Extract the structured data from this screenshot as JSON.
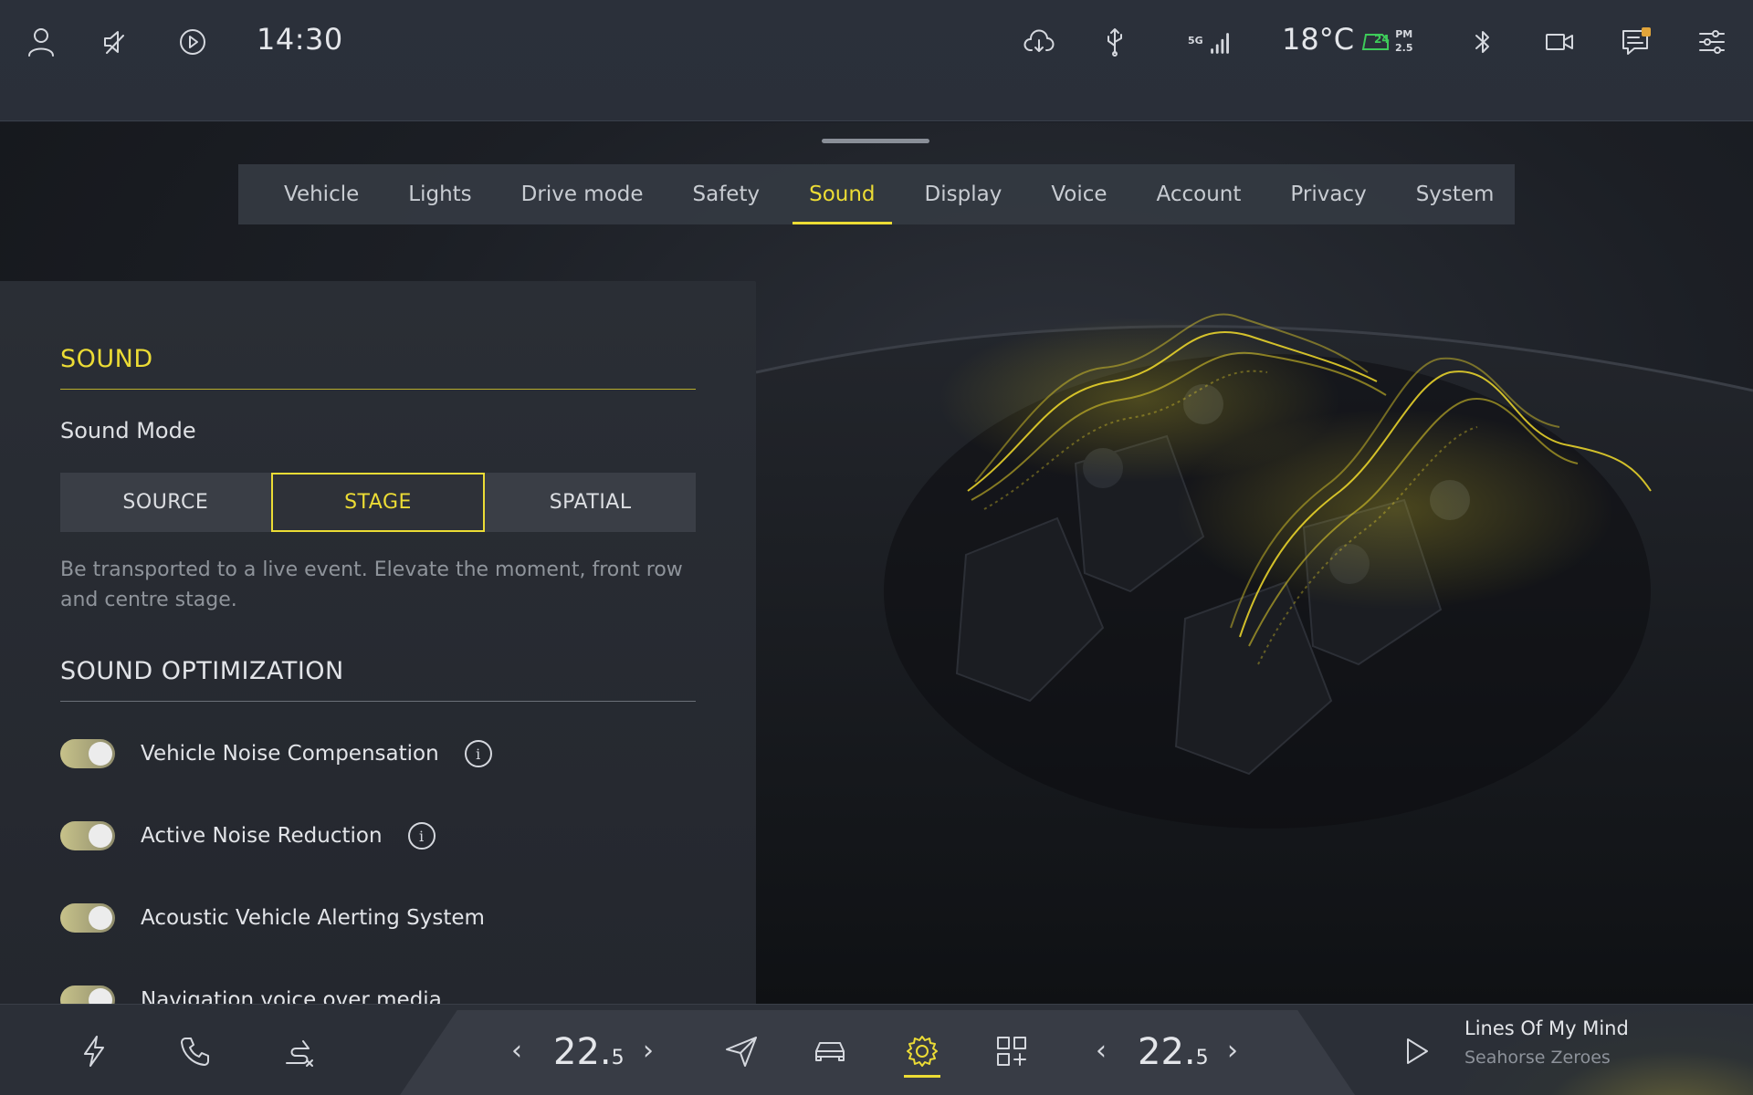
{
  "status_bar": {
    "time": "14:30",
    "signal_label": "5G",
    "temperature": "18°C",
    "aqi_value": "24",
    "pm_label": "PM",
    "pm_value": "2.5",
    "icons": [
      "profile-icon",
      "mute-icon",
      "play-circle-icon",
      "cloud-download-icon",
      "usb-icon",
      "signal-icon",
      "aqi-icon",
      "bluetooth-icon",
      "camera-icon",
      "messages-icon",
      "settings-sliders-icon"
    ]
  },
  "tabs": [
    {
      "label": "Vehicle"
    },
    {
      "label": "Lights"
    },
    {
      "label": "Drive mode"
    },
    {
      "label": "Safety"
    },
    {
      "label": "Sound",
      "active": true
    },
    {
      "label": "Display"
    },
    {
      "label": "Voice"
    },
    {
      "label": "Account"
    },
    {
      "label": "Privacy"
    },
    {
      "label": "System"
    }
  ],
  "sound": {
    "title": "SOUND",
    "mode_label": "Sound Mode",
    "modes": [
      "SOURCE",
      "STAGE",
      "SPATIAL"
    ],
    "selected_mode": "STAGE",
    "description": "Be transported to a live event. Elevate the moment, front row and centre stage.",
    "optimization_title": "SOUND OPTIMIZATION",
    "toggles": [
      {
        "label": "Vehicle Noise Compensation",
        "on": true,
        "info": true
      },
      {
        "label": "Active Noise Reduction",
        "on": true,
        "info": true
      },
      {
        "label": "Acoustic Vehicle Alerting System",
        "on": true,
        "info": false
      },
      {
        "label": "Navigation voice over media",
        "on": true,
        "info": false
      }
    ]
  },
  "dock": {
    "left_temp_main": "22.",
    "left_temp_decimal": "5",
    "right_temp_main": "22.",
    "right_temp_decimal": "5",
    "media_title": "Lines Of My Mind",
    "media_artist": "Seahorse Zeroes",
    "accent_color": "#ecdc35"
  }
}
